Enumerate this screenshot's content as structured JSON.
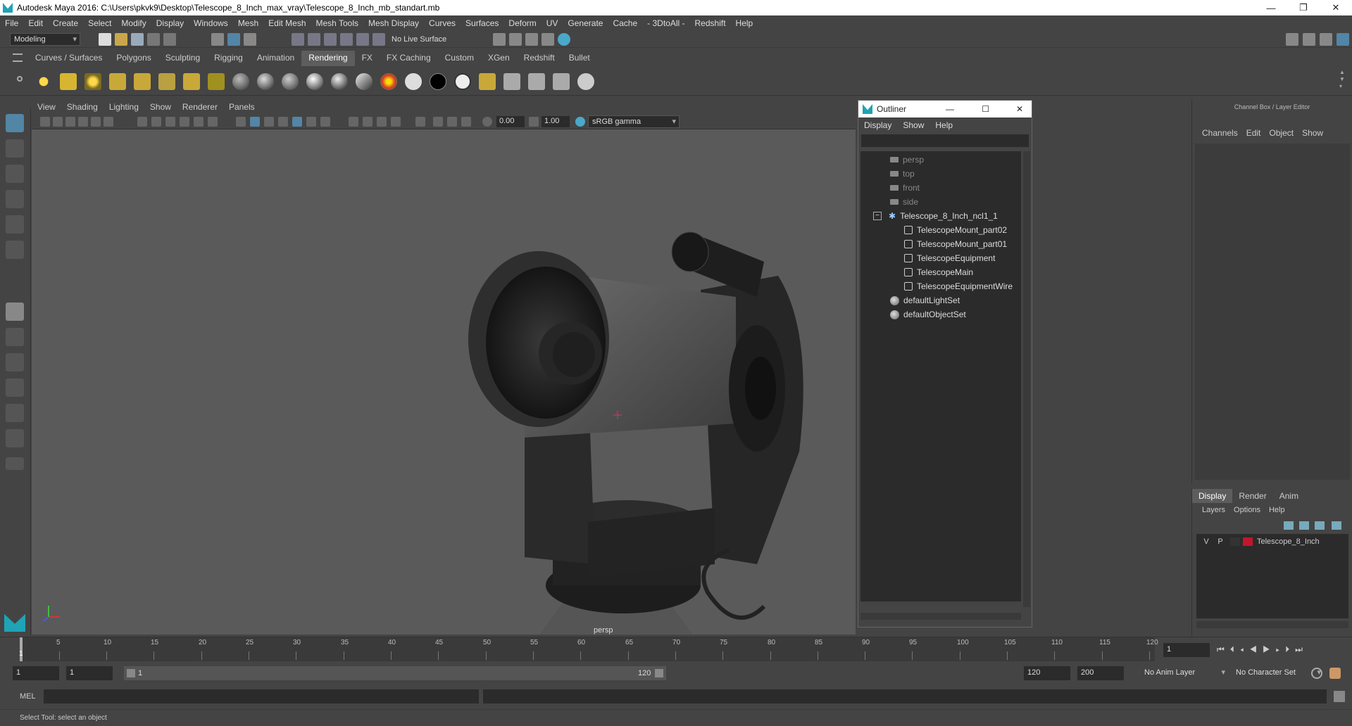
{
  "window": {
    "title": "Autodesk Maya 2016: C:\\Users\\pkvk9\\Desktop\\Telescope_8_Inch_max_vray\\Telescope_8_Inch_mb_standart.mb",
    "minimize": "—",
    "maximize": "❐",
    "close": "✕"
  },
  "menubar": [
    "File",
    "Edit",
    "Create",
    "Select",
    "Modify",
    "Display",
    "Windows",
    "Mesh",
    "Edit Mesh",
    "Mesh Tools",
    "Mesh Display",
    "Curves",
    "Surfaces",
    "Deform",
    "UV",
    "Generate",
    "Cache",
    "- 3DtoAll -",
    "Redshift",
    "Help"
  ],
  "statusline": {
    "mode": "Modeling",
    "live_surface": "No Live Surface"
  },
  "shelf_tabs": [
    "Curves / Surfaces",
    "Polygons",
    "Sculpting",
    "Rigging",
    "Animation",
    "Rendering",
    "FX",
    "FX Caching",
    "Custom",
    "XGen",
    "Redshift",
    "Bullet"
  ],
  "shelf_active": "Rendering",
  "viewport": {
    "menu": [
      "View",
      "Shading",
      "Lighting",
      "Show",
      "Renderer",
      "Panels"
    ],
    "exposure": "0.00",
    "gamma": "1.00",
    "color_space": "sRGB gamma",
    "camera_label": "persp"
  },
  "outliner": {
    "title": "Outliner",
    "menu": [
      "Display",
      "Show",
      "Help"
    ],
    "items": [
      {
        "label": "persp",
        "type": "camera",
        "indent": 0
      },
      {
        "label": "top",
        "type": "camera",
        "indent": 0
      },
      {
        "label": "front",
        "type": "camera",
        "indent": 0
      },
      {
        "label": "side",
        "type": "camera",
        "indent": 0
      },
      {
        "label": "Telescope_8_Inch_ncl1_1",
        "type": "group",
        "indent": 0
      },
      {
        "label": "TelescopeMount_part02",
        "type": "mesh",
        "indent": 1
      },
      {
        "label": "TelescopeMount_part01",
        "type": "mesh",
        "indent": 1
      },
      {
        "label": "TelescopeEquipment",
        "type": "mesh",
        "indent": 1
      },
      {
        "label": "TelescopeMain",
        "type": "mesh",
        "indent": 1
      },
      {
        "label": "TelescopeEquipmentWire",
        "type": "mesh",
        "indent": 1
      },
      {
        "label": "defaultLightSet",
        "type": "set",
        "indent": 0
      },
      {
        "label": "defaultObjectSet",
        "type": "set",
        "indent": 0
      }
    ]
  },
  "channelbox": {
    "title": "Channel Box / Layer Editor",
    "menu": [
      "Channels",
      "Edit",
      "Object",
      "Show"
    ]
  },
  "layer_editor": {
    "tabs": [
      "Display",
      "Render",
      "Anim"
    ],
    "menu": [
      "Layers",
      "Options",
      "Help"
    ],
    "layer": {
      "v": "V",
      "p": "P",
      "name": "Telescope_8_Inch",
      "color": "#c0172c"
    }
  },
  "timeline": {
    "ticks": [
      "5",
      "10",
      "15",
      "20",
      "25",
      "30",
      "35",
      "40",
      "45",
      "50",
      "55",
      "60",
      "65",
      "70",
      "75",
      "80",
      "85",
      "90",
      "95",
      "100",
      "105",
      "110",
      "115",
      "120"
    ],
    "current_frame_label": "1",
    "current_frame_field": "1"
  },
  "range": {
    "start": "1",
    "inner_start": "1",
    "slider_start": "1",
    "slider_end": "120",
    "end": "120",
    "anim_end": "200",
    "anim_layer": "No Anim Layer",
    "character_set": "No Character Set"
  },
  "cmdline": {
    "label": "MEL"
  },
  "helpline": {
    "text": "Select Tool: select an object"
  },
  "colors": {
    "ui_bg": "#444444",
    "field_bg": "#2b2b2b",
    "highlight": "#5285a6"
  }
}
